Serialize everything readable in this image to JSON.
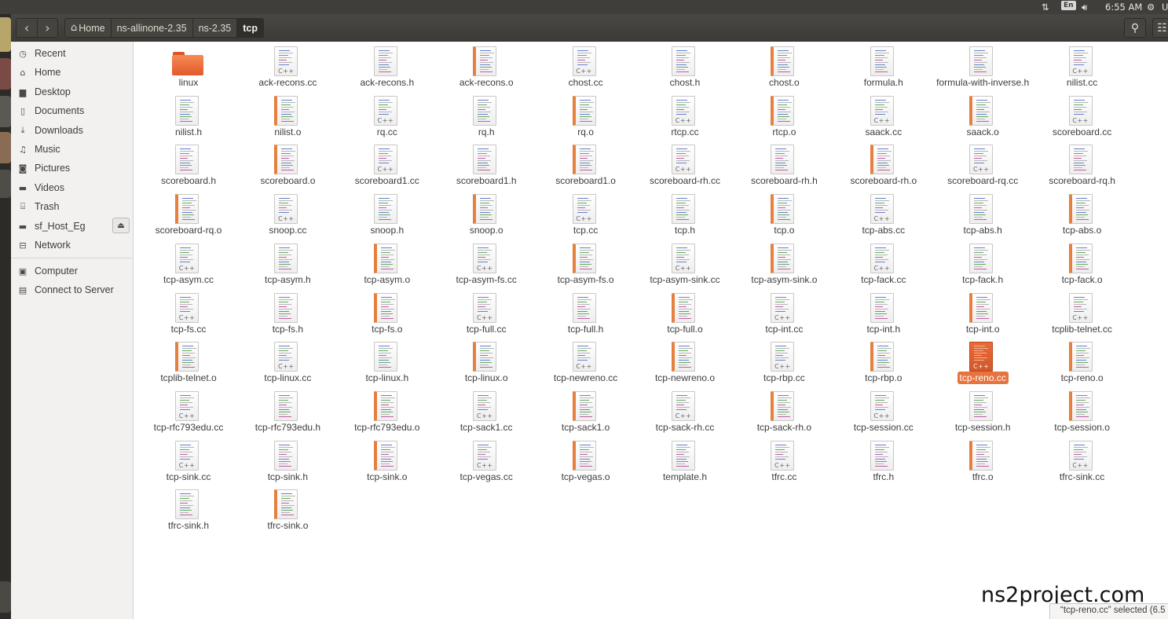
{
  "system_panel": {
    "network_icon": "network-arrows-icon",
    "keyboard_layout": "En",
    "volume_icon": "volume-icon",
    "clock": "6:55 AM",
    "user_initial": "U",
    "settings_icon": "gear-icon"
  },
  "header": {
    "back_icon": "chevron-left-icon",
    "forward_icon": "chevron-right-icon",
    "breadcrumbs": [
      "Home",
      "ns-allinone-2.35",
      "ns-2.35",
      "tcp"
    ],
    "search_icon": "search-icon",
    "view_menu_icon": "list-view-icon"
  },
  "sidebar": {
    "items": [
      {
        "label": "Recent",
        "icon": "clock-icon"
      },
      {
        "label": "Home",
        "icon": "home-icon"
      },
      {
        "label": "Desktop",
        "icon": "folder-icon"
      },
      {
        "label": "Documents",
        "icon": "document-icon"
      },
      {
        "label": "Downloads",
        "icon": "download-icon"
      },
      {
        "label": "Music",
        "icon": "music-icon"
      },
      {
        "label": "Pictures",
        "icon": "camera-icon"
      },
      {
        "label": "Videos",
        "icon": "video-icon"
      },
      {
        "label": "Trash",
        "icon": "trash-icon"
      },
      {
        "label": "sf_Host_Eg",
        "icon": "drive-icon"
      },
      {
        "label": "Network",
        "icon": "network-icon"
      }
    ],
    "devices": [
      {
        "label": "Computer",
        "icon": "computer-icon"
      },
      {
        "label": "Connect to Server",
        "icon": "server-icon"
      }
    ],
    "eject_icon": "eject-icon"
  },
  "files": [
    {
      "name": "linux",
      "kind": "folder"
    },
    {
      "name": "ack-recons.cc",
      "kind": "cc"
    },
    {
      "name": "ack-recons.h",
      "kind": "h"
    },
    {
      "name": "ack-recons.o",
      "kind": "o"
    },
    {
      "name": "chost.cc",
      "kind": "cc"
    },
    {
      "name": "chost.h",
      "kind": "h"
    },
    {
      "name": "chost.o",
      "kind": "o"
    },
    {
      "name": "formula.h",
      "kind": "h"
    },
    {
      "name": "formula-with-inverse.h",
      "kind": "h"
    },
    {
      "name": "nilist.cc",
      "kind": "cc"
    },
    {
      "name": "nilist.h",
      "kind": "h"
    },
    {
      "name": "nilist.o",
      "kind": "o"
    },
    {
      "name": "rq.cc",
      "kind": "cc"
    },
    {
      "name": "rq.h",
      "kind": "h"
    },
    {
      "name": "rq.o",
      "kind": "o"
    },
    {
      "name": "rtcp.cc",
      "kind": "cc"
    },
    {
      "name": "rtcp.o",
      "kind": "o"
    },
    {
      "name": "saack.cc",
      "kind": "cc"
    },
    {
      "name": "saack.o",
      "kind": "o"
    },
    {
      "name": "scoreboard.cc",
      "kind": "cc"
    },
    {
      "name": "scoreboard.h",
      "kind": "h"
    },
    {
      "name": "scoreboard.o",
      "kind": "o"
    },
    {
      "name": "scoreboard1.cc",
      "kind": "cc"
    },
    {
      "name": "scoreboard1.h",
      "kind": "h"
    },
    {
      "name": "scoreboard1.o",
      "kind": "o"
    },
    {
      "name": "scoreboard-rh.cc",
      "kind": "cc"
    },
    {
      "name": "scoreboard-rh.h",
      "kind": "h"
    },
    {
      "name": "scoreboard-rh.o",
      "kind": "o"
    },
    {
      "name": "scoreboard-rq.cc",
      "kind": "cc"
    },
    {
      "name": "scoreboard-rq.h",
      "kind": "h"
    },
    {
      "name": "scoreboard-rq.o",
      "kind": "o"
    },
    {
      "name": "snoop.cc",
      "kind": "cc"
    },
    {
      "name": "snoop.h",
      "kind": "h"
    },
    {
      "name": "snoop.o",
      "kind": "o"
    },
    {
      "name": "tcp.cc",
      "kind": "cc"
    },
    {
      "name": "tcp.h",
      "kind": "h"
    },
    {
      "name": "tcp.o",
      "kind": "o"
    },
    {
      "name": "tcp-abs.cc",
      "kind": "cc"
    },
    {
      "name": "tcp-abs.h",
      "kind": "h"
    },
    {
      "name": "tcp-abs.o",
      "kind": "o"
    },
    {
      "name": "tcp-asym.cc",
      "kind": "cc"
    },
    {
      "name": "tcp-asym.h",
      "kind": "h"
    },
    {
      "name": "tcp-asym.o",
      "kind": "o"
    },
    {
      "name": "tcp-asym-fs.cc",
      "kind": "cc"
    },
    {
      "name": "tcp-asym-fs.o",
      "kind": "o"
    },
    {
      "name": "tcp-asym-sink.cc",
      "kind": "cc"
    },
    {
      "name": "tcp-asym-sink.o",
      "kind": "o"
    },
    {
      "name": "tcp-fack.cc",
      "kind": "cc"
    },
    {
      "name": "tcp-fack.h",
      "kind": "h"
    },
    {
      "name": "tcp-fack.o",
      "kind": "o"
    },
    {
      "name": "tcp-fs.cc",
      "kind": "cc"
    },
    {
      "name": "tcp-fs.h",
      "kind": "h"
    },
    {
      "name": "tcp-fs.o",
      "kind": "o"
    },
    {
      "name": "tcp-full.cc",
      "kind": "cc"
    },
    {
      "name": "tcp-full.h",
      "kind": "h"
    },
    {
      "name": "tcp-full.o",
      "kind": "o"
    },
    {
      "name": "tcp-int.cc",
      "kind": "cc"
    },
    {
      "name": "tcp-int.h",
      "kind": "h"
    },
    {
      "name": "tcp-int.o",
      "kind": "o"
    },
    {
      "name": "tcplib-telnet.cc",
      "kind": "cc"
    },
    {
      "name": "tcplib-telnet.o",
      "kind": "o"
    },
    {
      "name": "tcp-linux.cc",
      "kind": "cc"
    },
    {
      "name": "tcp-linux.h",
      "kind": "h"
    },
    {
      "name": "tcp-linux.o",
      "kind": "o"
    },
    {
      "name": "tcp-newreno.cc",
      "kind": "cc"
    },
    {
      "name": "tcp-newreno.o",
      "kind": "o"
    },
    {
      "name": "tcp-rbp.cc",
      "kind": "cc"
    },
    {
      "name": "tcp-rbp.o",
      "kind": "o"
    },
    {
      "name": "tcp-reno.cc",
      "kind": "cc",
      "selected": true
    },
    {
      "name": "tcp-reno.o",
      "kind": "o"
    },
    {
      "name": "tcp-rfc793edu.cc",
      "kind": "cc"
    },
    {
      "name": "tcp-rfc793edu.h",
      "kind": "h"
    },
    {
      "name": "tcp-rfc793edu.o",
      "kind": "o"
    },
    {
      "name": "tcp-sack1.cc",
      "kind": "cc"
    },
    {
      "name": "tcp-sack1.o",
      "kind": "o"
    },
    {
      "name": "tcp-sack-rh.cc",
      "kind": "cc"
    },
    {
      "name": "tcp-sack-rh.o",
      "kind": "o"
    },
    {
      "name": "tcp-session.cc",
      "kind": "cc"
    },
    {
      "name": "tcp-session.h",
      "kind": "h"
    },
    {
      "name": "tcp-session.o",
      "kind": "o"
    },
    {
      "name": "tcp-sink.cc",
      "kind": "cc"
    },
    {
      "name": "tcp-sink.h",
      "kind": "h"
    },
    {
      "name": "tcp-sink.o",
      "kind": "o"
    },
    {
      "name": "tcp-vegas.cc",
      "kind": "cc"
    },
    {
      "name": "tcp-vegas.o",
      "kind": "o"
    },
    {
      "name": "template.h",
      "kind": "h"
    },
    {
      "name": "tfrc.cc",
      "kind": "cc"
    },
    {
      "name": "tfrc.h",
      "kind": "h"
    },
    {
      "name": "tfrc.o",
      "kind": "o"
    },
    {
      "name": "tfrc-sink.cc",
      "kind": "cc"
    },
    {
      "name": "tfrc-sink.h",
      "kind": "h"
    },
    {
      "name": "tfrc-sink.o",
      "kind": "o"
    }
  ],
  "file_badge_text": "C++",
  "statusbar": {
    "text": "“tcp-reno.cc” selected  (6.5"
  },
  "watermark": "ns2project.com",
  "colors": {
    "accent": "#e7733f",
    "header": "#3c3b37",
    "sidebar": "#f2f1f0"
  }
}
